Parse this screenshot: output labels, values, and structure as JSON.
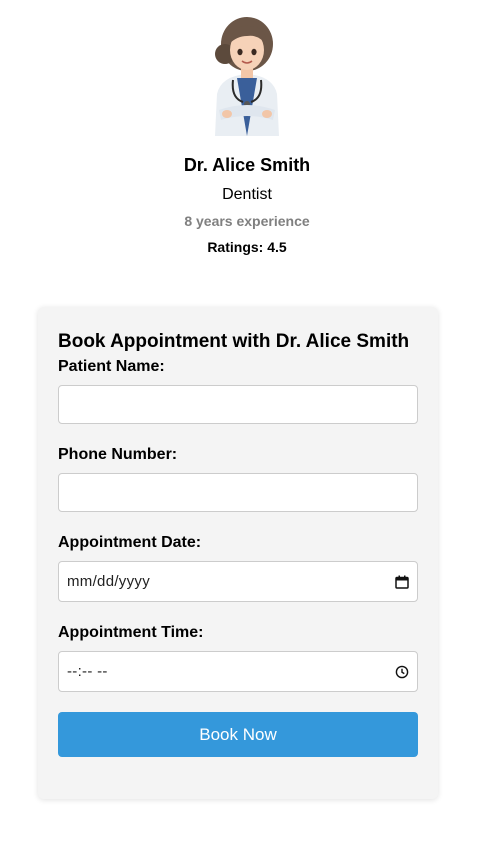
{
  "doctor": {
    "name": "Dr. Alice Smith",
    "specialty": "Dentist",
    "experience": "8 years experience",
    "ratings": "Ratings: 4.5"
  },
  "form": {
    "title": "Book Appointment with Dr. Alice Smith",
    "fields": {
      "patient_name": {
        "label": "Patient Name:",
        "value": ""
      },
      "phone": {
        "label": "Phone Number:",
        "value": ""
      },
      "date": {
        "label": "Appointment Date:",
        "placeholder": "mm/dd/yyyy",
        "icon": "calendar-icon"
      },
      "time": {
        "label": "Appointment Time:",
        "placeholder": "--:-- --",
        "icon": "clock-icon"
      }
    },
    "submit_label": "Book Now"
  },
  "colors": {
    "accent": "#3498db",
    "card_bg": "#f4f4f4",
    "muted_text": "#808080"
  }
}
